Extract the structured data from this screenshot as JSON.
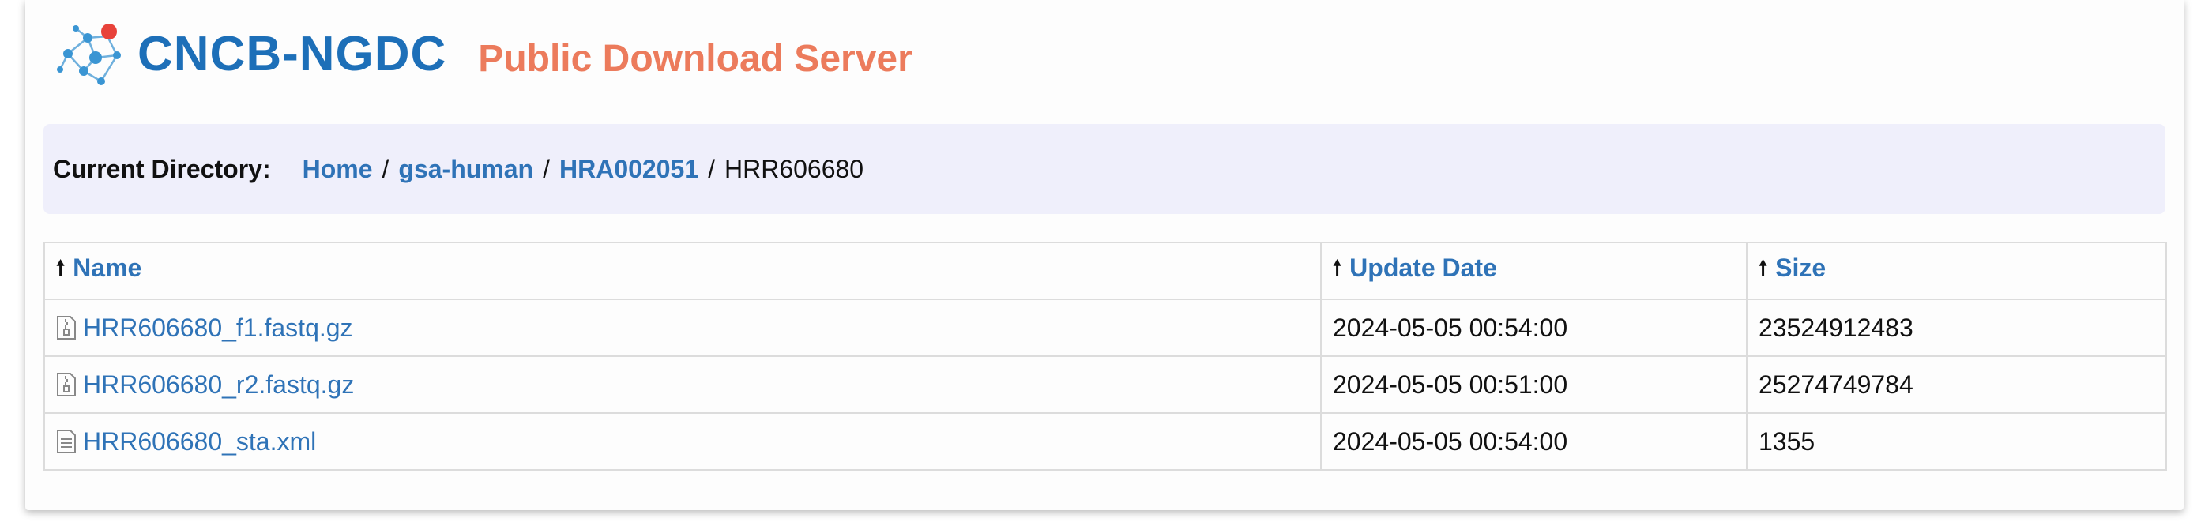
{
  "header": {
    "logo_text": "CNCB-NGDC",
    "site_title": "Public Download Server"
  },
  "directory": {
    "label": "Current Directory:",
    "breadcrumbs": [
      {
        "label": "Home",
        "link": true
      },
      {
        "label": "gsa-human",
        "link": true
      },
      {
        "label": "HRA002051",
        "link": true
      },
      {
        "label": "HRR606680",
        "link": false
      }
    ]
  },
  "table": {
    "columns": [
      {
        "label": "Name",
        "sort_icon": "arrow-up-icon"
      },
      {
        "label": "Update Date",
        "sort_icon": "arrow-up-icon"
      },
      {
        "label": "Size",
        "sort_icon": "arrow-up-icon"
      }
    ],
    "rows": [
      {
        "icon": "archive-file-icon",
        "name": "HRR606680_f1.fastq.gz",
        "date": "2024-05-05 00:54:00",
        "size": "23524912483"
      },
      {
        "icon": "archive-file-icon",
        "name": "HRR606680_r2.fastq.gz",
        "date": "2024-05-05 00:51:00",
        "size": "25274749784"
      },
      {
        "icon": "text-file-icon",
        "name": "HRR606680_sta.xml",
        "date": "2024-05-05 00:54:00",
        "size": "1355"
      }
    ]
  },
  "colors": {
    "link": "#2f73b7",
    "title": "#ec7b5c",
    "logo": "#1d6fb8",
    "dirbar_bg": "#efeffb"
  }
}
